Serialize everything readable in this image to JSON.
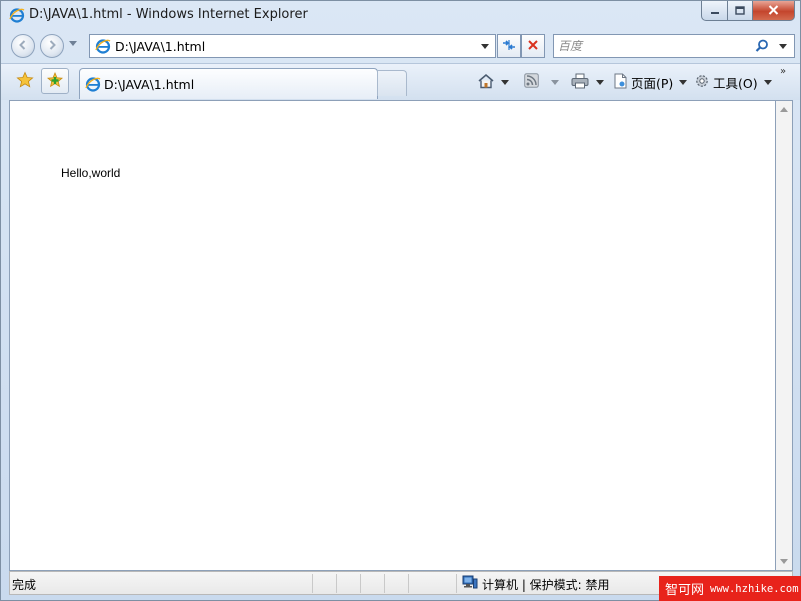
{
  "window": {
    "title": "D:\\JAVA\\1.html - Windows Internet Explorer"
  },
  "caption_buttons": {
    "minimize_icon": "minimize-icon",
    "maximize_icon": "maximize-icon",
    "close_icon": "close-icon"
  },
  "navigation": {
    "address": "D:\\JAVA\\1.html",
    "search_placeholder": "百度",
    "icons": [
      "back-icon",
      "forward-icon",
      "refresh-icon",
      "stop-icon",
      "search-icon"
    ]
  },
  "tabs": [
    {
      "label": "D:\\JAVA\\1.html",
      "active": true
    }
  ],
  "command_bar": {
    "page_label": "页面(P)",
    "tools_label": "工具(O)",
    "more": "»",
    "icons": [
      "home-icon",
      "rss-feed-icon",
      "print-icon",
      "page-icon",
      "tools-gear-icon"
    ]
  },
  "content": {
    "text": "Hello,world"
  },
  "status_bar": {
    "status": "完成",
    "zone": "计算机 | 保护模式: 禁用"
  },
  "watermark": {
    "name": "智可网",
    "url": "www.hzhike.com"
  },
  "colors": {
    "chrome_blue": "#c9daee",
    "close_red": "#c4452d",
    "watermark_red": "#e8231b"
  }
}
